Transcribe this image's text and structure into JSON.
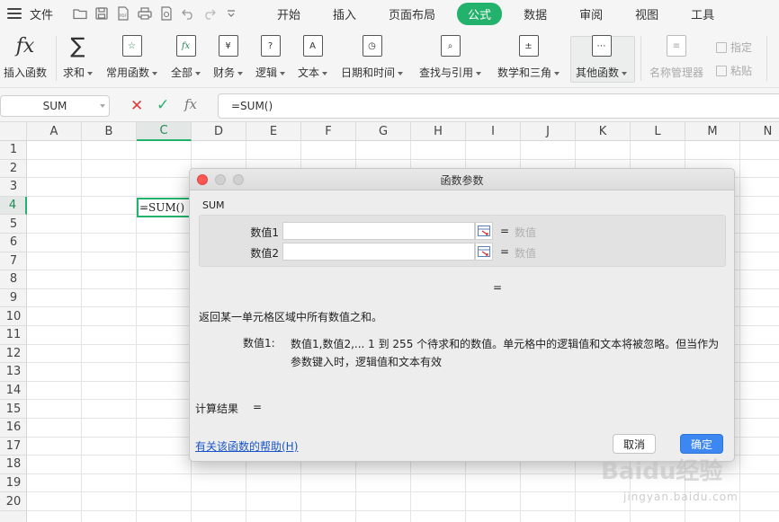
{
  "menubar": {
    "file_label": "文件",
    "tabs": [
      {
        "label": "开始",
        "active": false
      },
      {
        "label": "插入",
        "active": false
      },
      {
        "label": "页面布局",
        "active": false
      },
      {
        "label": "公式",
        "active": true
      },
      {
        "label": "数据",
        "active": false
      },
      {
        "label": "审阅",
        "active": false
      },
      {
        "label": "视图",
        "active": false
      },
      {
        "label": "工具",
        "active": false
      }
    ]
  },
  "ribbon": {
    "insert_function": "插入函数",
    "sum": "求和",
    "common": "常用函数",
    "all": "全部",
    "finance": "财务",
    "logic": "逻辑",
    "text": "文本",
    "datetime": "日期和时间",
    "lookup": "查找与引用",
    "math": "数学和三角",
    "other": "其他函数",
    "name_manager": "名称管理器",
    "specify": "指定",
    "paste": "粘贴"
  },
  "formula_bar": {
    "name_box": "SUM",
    "formula": "=SUM()"
  },
  "grid": {
    "columns": [
      "A",
      "B",
      "C",
      "D",
      "E",
      "F",
      "G",
      "H",
      "I",
      "J",
      "K",
      "L",
      "M",
      "N"
    ],
    "selected_column": "C",
    "rows": [
      "1",
      "2",
      "3",
      "4",
      "5",
      "6",
      "7",
      "8",
      "9",
      "10",
      "11",
      "12",
      "13",
      "14",
      "15",
      "16",
      "17",
      "18",
      "19",
      "20"
    ],
    "selected_row": "4",
    "active_cell_value": "=SUM()"
  },
  "dialog": {
    "title": "函数参数",
    "function_name": "SUM",
    "args": [
      {
        "label": "数值1",
        "value": "",
        "eq": "=",
        "type": "数值"
      },
      {
        "label": "数值2",
        "value": "",
        "eq": "=",
        "type": "数值"
      }
    ],
    "result_eq": "=",
    "description": "返回某一单元格区域中所有数值之和。",
    "param_name": "数值1:",
    "param_desc": "数值1,数值2,... 1 到 255 个待求和的数值。单元格中的逻辑值和文本将被忽略。但当作为参数键入时，逻辑值和文本有效",
    "calc_label": "计算结果",
    "calc_eq": "=",
    "help_link": "有关该函数的帮助(H)",
    "cancel": "取消",
    "ok": "确定"
  },
  "watermark": {
    "brand": "Baidu经验",
    "url": "jingyan.baidu.com"
  },
  "colors": {
    "accent_green": "#23b26b",
    "ok_blue": "#3d87f3",
    "cancel_red": "#e03a3a",
    "link_blue": "#1a55c8"
  }
}
